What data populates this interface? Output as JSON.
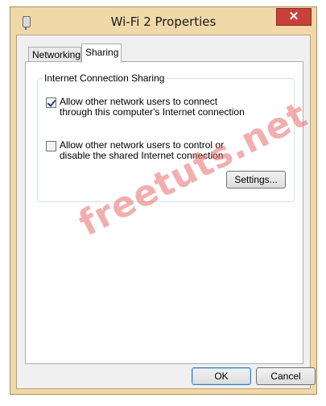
{
  "window": {
    "title": "Wi-Fi 2 Properties",
    "close_glyph": "✕"
  },
  "tabs": [
    {
      "label": "Networking",
      "selected": false
    },
    {
      "label": "Sharing",
      "selected": true
    }
  ],
  "sharing": {
    "group_label": "Internet Connection Sharing",
    "option1": {
      "label": "Allow other network users to connect through this computer's Internet connection",
      "checked": true
    },
    "option2": {
      "label": "Allow other network users to control or disable the shared Internet connection",
      "checked": false
    },
    "settings_button": "Settings..."
  },
  "buttons": {
    "ok": "OK",
    "cancel": "Cancel"
  },
  "watermark": "freetuts.net",
  "colors": {
    "frame": "#f0d8a8",
    "close": "#c7403a",
    "watermark": "#e86c6c"
  }
}
